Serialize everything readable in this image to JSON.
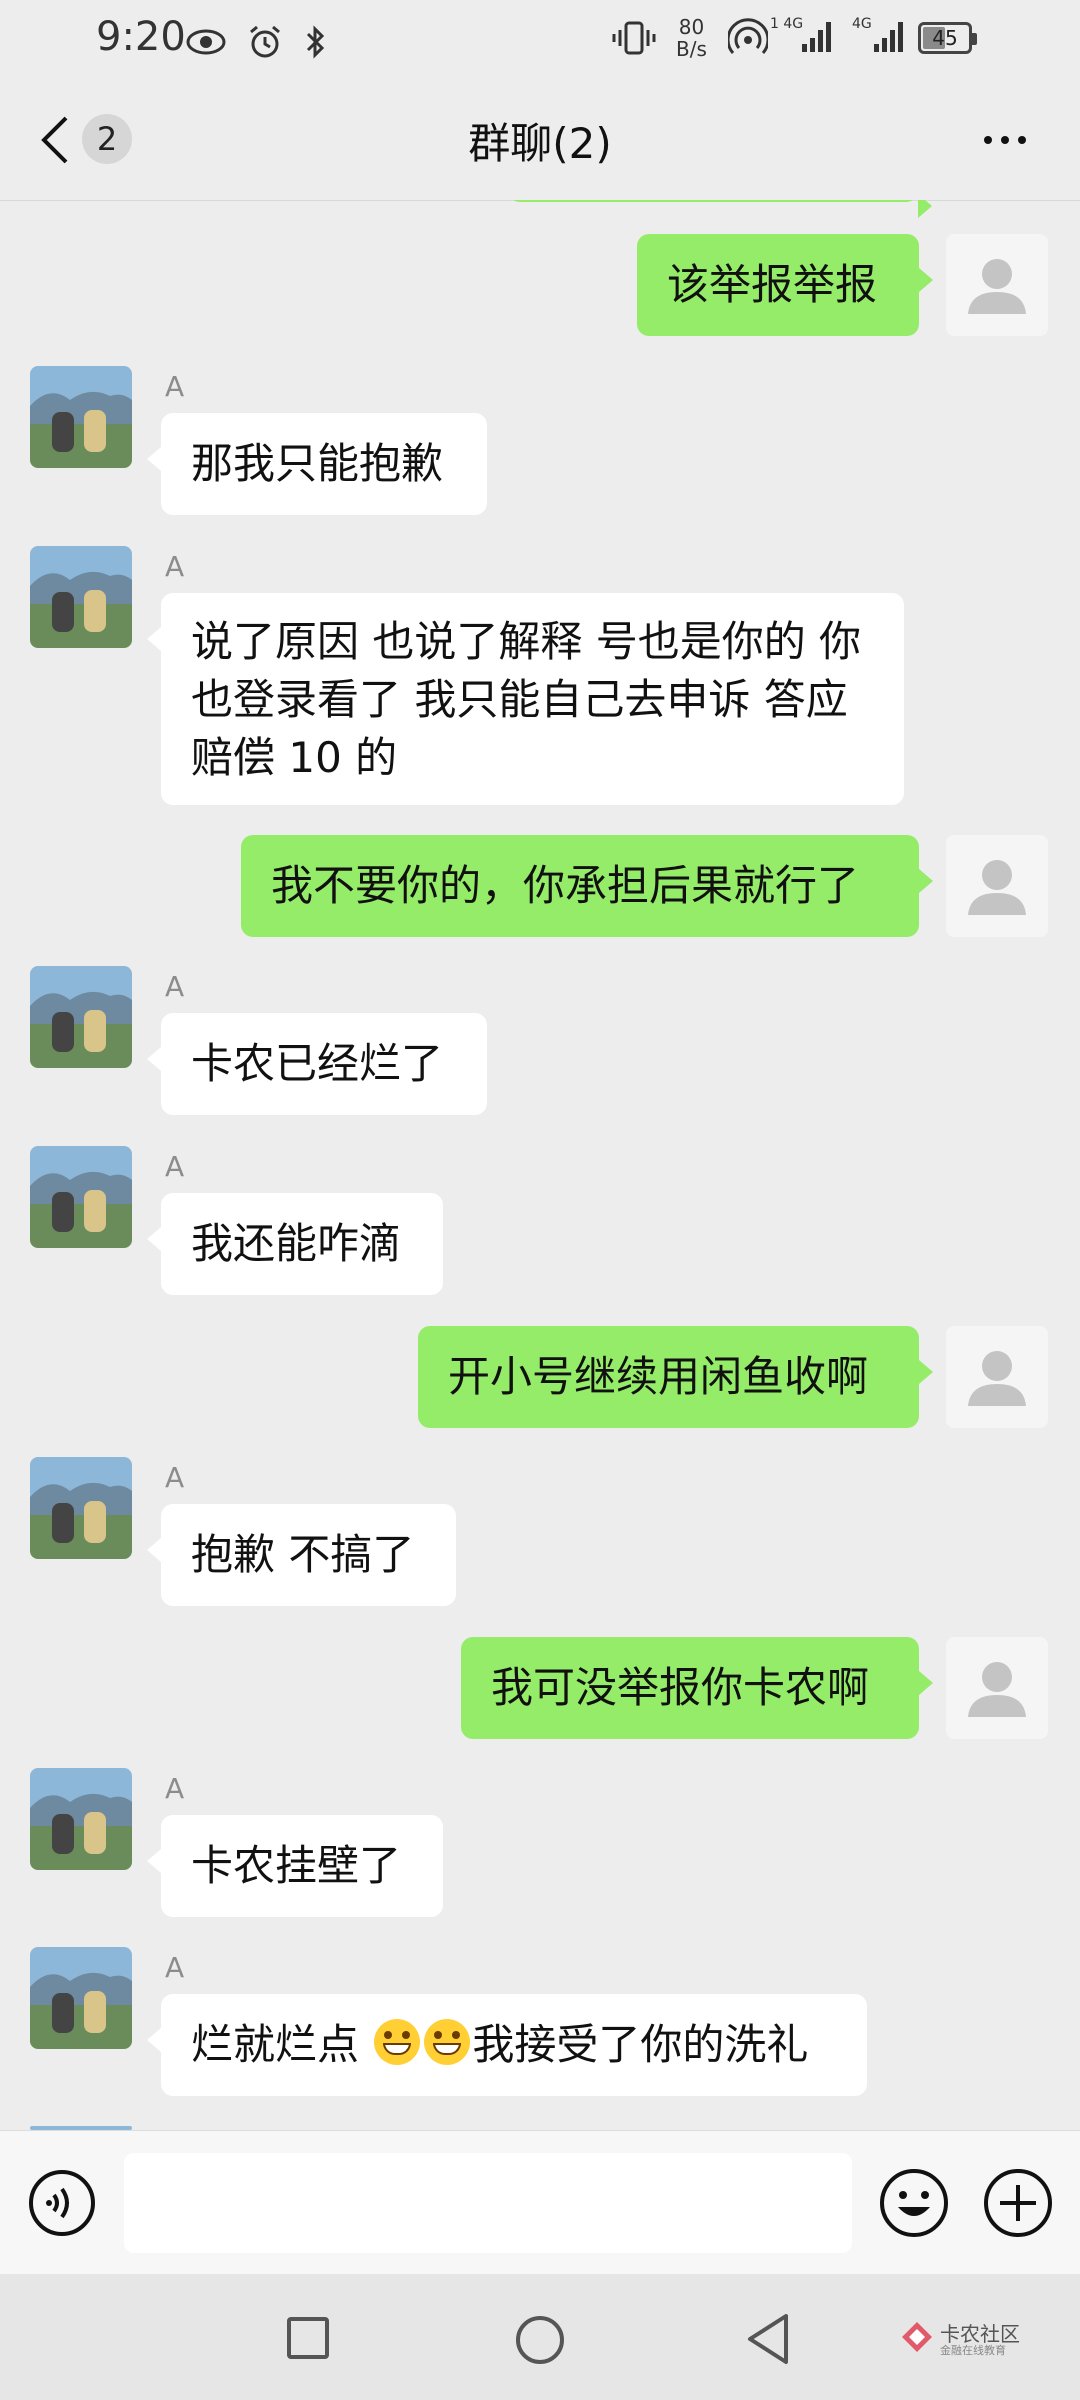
{
  "status_bar": {
    "time": "9:20",
    "network_speed_value": "80",
    "network_speed_unit": "B/s",
    "signal_1": "1 4G",
    "signal_2": "4G",
    "battery": "45"
  },
  "header": {
    "back_badge": "2",
    "title": "群聊(2)"
  },
  "messages": [
    {
      "side": "self",
      "text": "该举报举报"
    },
    {
      "side": "other",
      "sender": "A",
      "text": "那我只能抱歉"
    },
    {
      "side": "other",
      "sender": "A",
      "text_lines": [
        "说了原因 也说了解释 号也是你的 你",
        "也登录看了 我只能自己去申诉 答应",
        "赔偿 10 的"
      ]
    },
    {
      "side": "self",
      "text": "我不要你的，你承担后果就行了"
    },
    {
      "side": "other",
      "sender": "A",
      "text": "卡农已经烂了"
    },
    {
      "side": "other",
      "sender": "A",
      "text": "我还能咋滴"
    },
    {
      "side": "self",
      "text": "开小号继续用闲鱼收啊"
    },
    {
      "side": "other",
      "sender": "A",
      "text": "抱歉 不搞了"
    },
    {
      "side": "self",
      "text": "我可没举报你卡农啊"
    },
    {
      "side": "other",
      "sender": "A",
      "text": "卡农挂壁了"
    },
    {
      "side": "other",
      "sender": "A",
      "text_before": "烂就烂点 ",
      "emoji_name": "grinning-face-emoji",
      "emoji_count": 2,
      "text_after": "我接受了你的洗礼"
    }
  ],
  "watermark": {
    "title": "卡农社区",
    "subtitle": "金融在线教育"
  },
  "colors": {
    "background": "#ededed",
    "self_bubble": "#95ec69",
    "other_bubble": "#ffffff"
  }
}
